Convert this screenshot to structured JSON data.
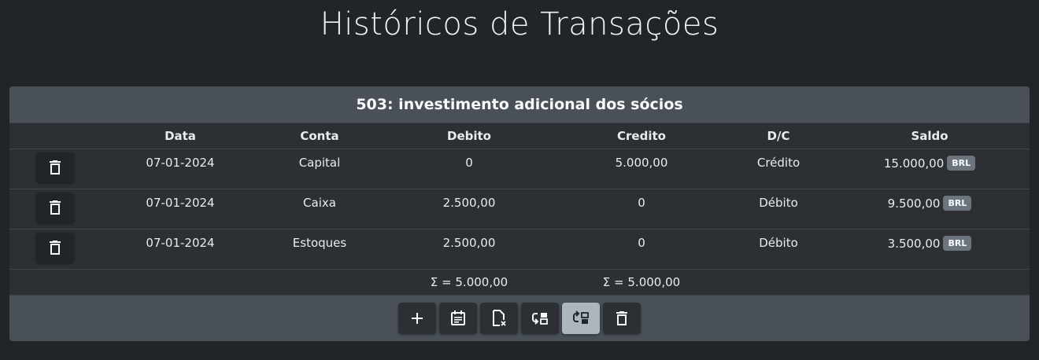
{
  "page": {
    "title": "Históricos de Transações"
  },
  "card": {
    "header": "503: investimento adicional dos sócios",
    "columns": [
      "Data",
      "Conta",
      "Debito",
      "Credito",
      "D/C",
      "Saldo"
    ],
    "rows": [
      {
        "data": "07-01-2024",
        "conta": "Capital",
        "debito": "0",
        "credito": "5.000,00",
        "dc": "Crédito",
        "saldo": "15.000,00",
        "currency": "BRL"
      },
      {
        "data": "07-01-2024",
        "conta": "Caixa",
        "debito": "2.500,00",
        "credito": "0",
        "dc": "Débito",
        "saldo": "9.500,00",
        "currency": "BRL"
      },
      {
        "data": "07-01-2024",
        "conta": "Estoques",
        "debito": "2.500,00",
        "credito": "0",
        "dc": "Débito",
        "saldo": "3.500,00",
        "currency": "BRL"
      }
    ],
    "totals": {
      "debito": "Σ = 5.000,00",
      "credito": "Σ = 5.000,00"
    }
  },
  "toolbar": {
    "buttons": [
      {
        "icon": "plus-icon"
      },
      {
        "icon": "calendar-icon"
      },
      {
        "icon": "file-remove-icon"
      },
      {
        "icon": "swap-left-icon"
      },
      {
        "icon": "swap-right-icon",
        "active": true
      },
      {
        "icon": "trash-icon"
      }
    ]
  },
  "colors": {
    "background": "#212529",
    "card": "#2c3034",
    "header": "#495057",
    "badge": "#6c757d",
    "active_button": "#adb5bd"
  }
}
